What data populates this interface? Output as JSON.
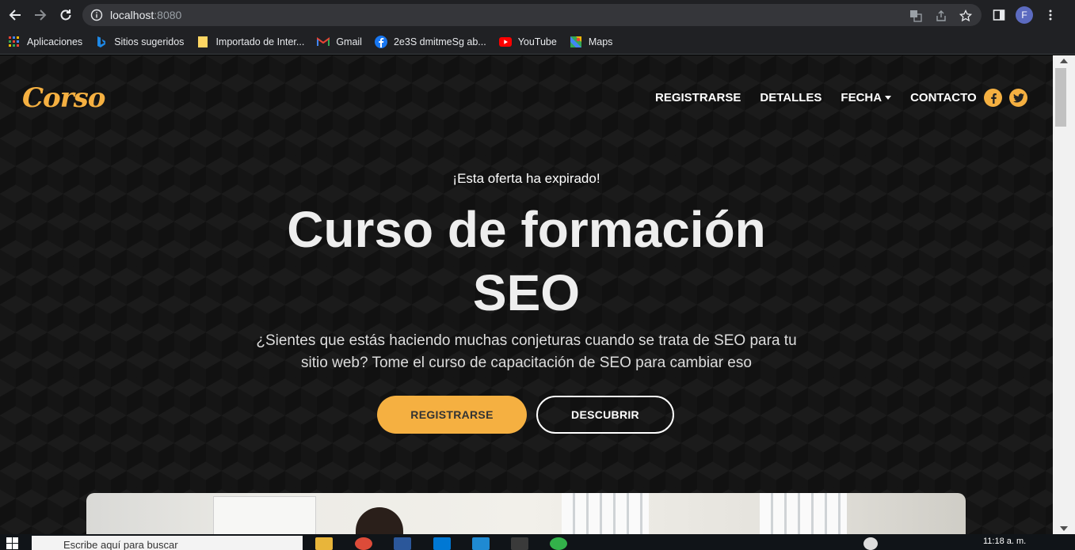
{
  "browser": {
    "url_host": "localhost",
    "url_port": ":8080",
    "profile_initial": "F",
    "bookmarks": [
      {
        "label": "Aplicaciones",
        "icon": "apps-grid-icon"
      },
      {
        "label": "Sitios sugeridos",
        "icon": "bing-icon"
      },
      {
        "label": "Importado de Inter...",
        "icon": "folder-icon"
      },
      {
        "label": "Gmail",
        "icon": "gmail-icon"
      },
      {
        "label": "2e3S dmitmeSg ab...",
        "icon": "facebook-icon"
      },
      {
        "label": "YouTube",
        "icon": "youtube-icon"
      },
      {
        "label": "Maps",
        "icon": "maps-icon"
      }
    ]
  },
  "site": {
    "logo": "Corso",
    "nav": {
      "registrarse": "REGISTRARSE",
      "detalles": "DETALLES",
      "fecha": "FECHA",
      "contacto": "CONTACTO"
    },
    "accent": "#f5b041"
  },
  "hero": {
    "kicker": "¡Esta oferta ha expirado!",
    "title_line1": "Curso de formación",
    "title_line2": "SEO",
    "subtitle_line1": "¿Sientes que estás haciendo muchas conjeturas cuando se trata de SEO para tu",
    "subtitle_line2": "sitio web? Tome el curso de capacitación de SEO para cambiar eso",
    "primary_button": "REGISTRARSE",
    "secondary_button": "DESCUBRIR"
  },
  "taskbar": {
    "search_placeholder": "Escribe aquí para buscar",
    "clock": "11:18 a. m."
  }
}
